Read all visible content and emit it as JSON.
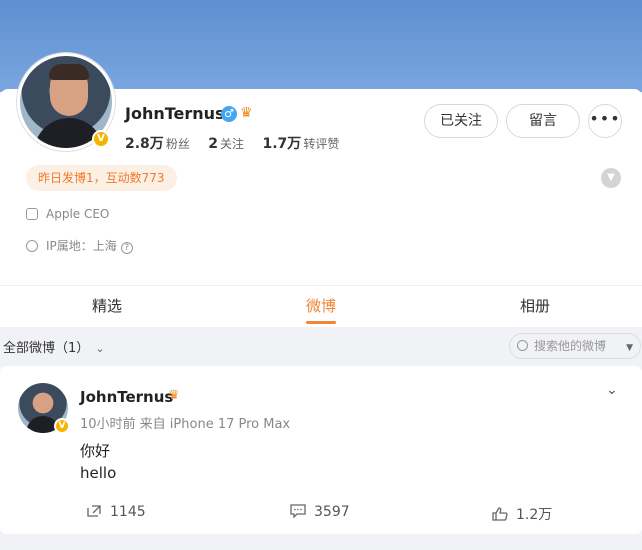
{
  "profile": {
    "name": "JohnTernus",
    "stats": [
      {
        "value": "2.8万",
        "label": "粉丝"
      },
      {
        "value": "2",
        "label": "关注"
      },
      {
        "value": "1.7万",
        "label": "转评赞"
      }
    ],
    "buttons": {
      "follow": "已关注",
      "message": "留言",
      "more": "•••"
    },
    "activity": "昨日发博1，互动数773",
    "title": "Apple CEO",
    "ip": "IP属地：上海",
    "verified_badge": "V",
    "gender_icon": "male-icon"
  },
  "tabs": [
    "精选",
    "微博",
    "相册"
  ],
  "active_tab": "微博",
  "filter": {
    "label": "全部微博（1）",
    "search_placeholder": "搜索他的微博"
  },
  "post": {
    "author": "JohnTernus",
    "meta": "10小时前 来自 iPhone 17 Pro Max",
    "lines": [
      "你好",
      "hello"
    ],
    "actions": {
      "repost": "1145",
      "comment": "3597",
      "like": "1.2万"
    }
  },
  "colors": {
    "accent": "#f28633",
    "cover": "#7aa6e0",
    "verified": "#f5b400"
  }
}
